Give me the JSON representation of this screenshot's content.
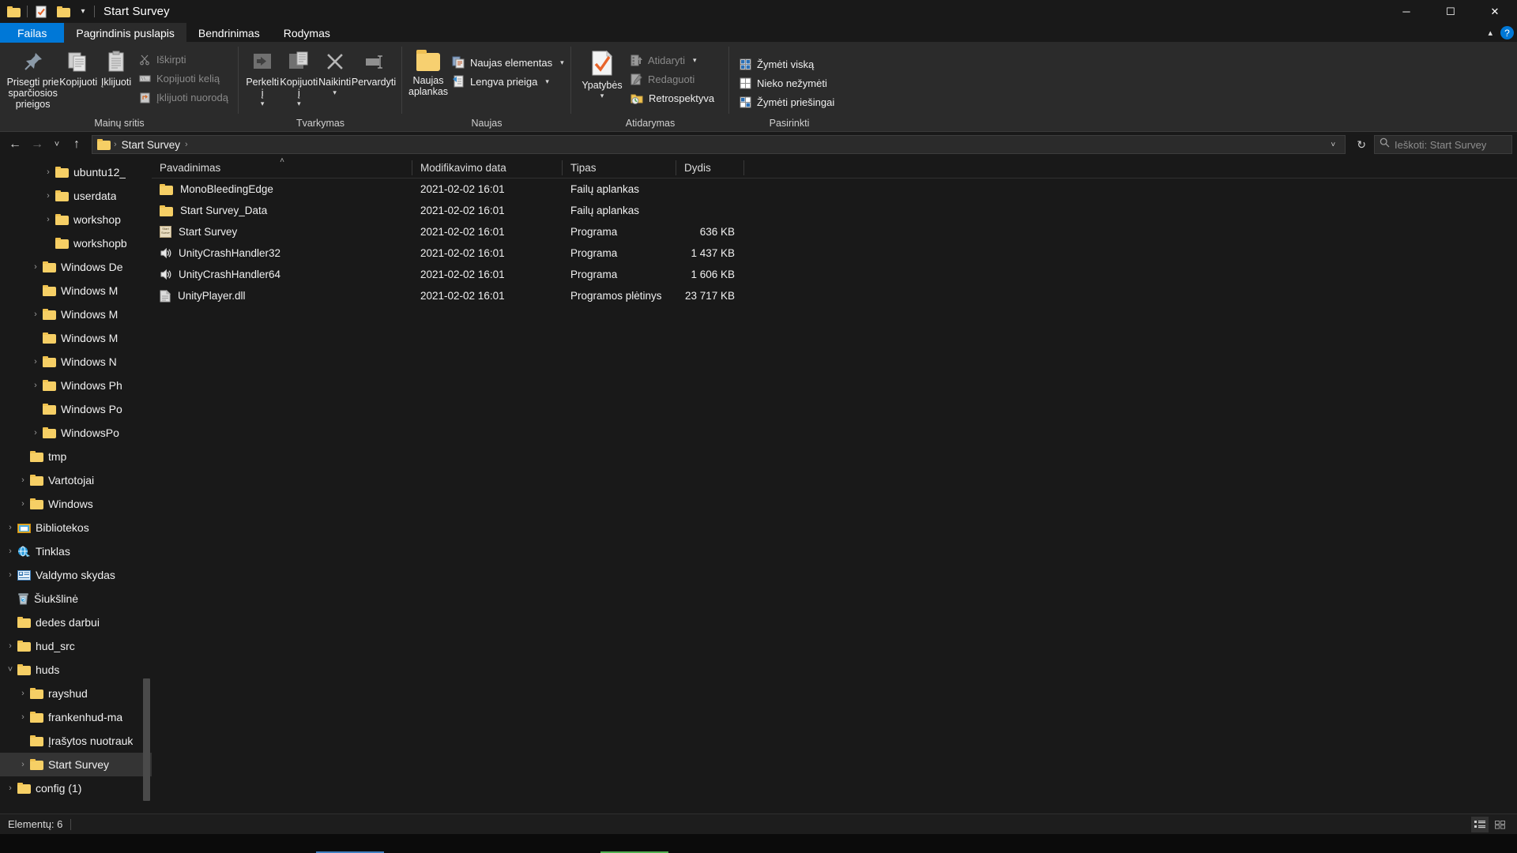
{
  "window": {
    "title": "Start Survey",
    "quick_access_icons": [
      "folder-icon",
      "properties-check-icon",
      "new-folder-icon"
    ],
    "customize_caret": "chevron-down-icon",
    "controls": {
      "minimize": "─",
      "maximize": "☐",
      "close": "✕"
    }
  },
  "tabs": [
    {
      "label": "Failas",
      "state": "file-menu"
    },
    {
      "label": "Pagrindinis puslapis",
      "state": "active"
    },
    {
      "label": "Bendrinimas",
      "state": "normal"
    },
    {
      "label": "Rodymas",
      "state": "normal"
    }
  ],
  "tabstrip_right": {
    "collapse": "chevron-up-icon",
    "help": "?"
  },
  "ribbon": {
    "groups": [
      {
        "title": "Mainų sritis",
        "big_buttons": [
          {
            "label": "Prisegti prie sparčiosios prieigos",
            "icon": "pin-icon"
          },
          {
            "label": "Kopijuoti",
            "icon": "copy-icon"
          },
          {
            "label": "Įklijuoti",
            "icon": "paste-icon"
          }
        ],
        "small_buttons": [
          {
            "label": "Iškirpti",
            "icon": "scissors-icon",
            "enabled": false
          },
          {
            "label": "Kopijuoti kelią",
            "icon": "copy-path-icon",
            "enabled": false
          },
          {
            "label": "Įklijuoti nuorodą",
            "icon": "paste-shortcut-icon",
            "enabled": false
          }
        ]
      },
      {
        "title": "Tvarkymas",
        "big_buttons": [
          {
            "label": "Perkelti į",
            "icon": "move-to-icon",
            "has_caret": true
          },
          {
            "label": "Kopijuoti į",
            "icon": "copy-to-icon",
            "has_caret": true
          },
          {
            "label": "Naikinti",
            "icon": "delete-x-icon",
            "has_caret": true
          },
          {
            "label": "Pervardyti",
            "icon": "rename-icon"
          }
        ]
      },
      {
        "title": "Naujas",
        "big_buttons": [
          {
            "label": "Naujas aplankas",
            "icon": "new-folder-icon"
          }
        ],
        "small_buttons": [
          {
            "label": "Naujas elementas",
            "icon": "new-item-icon",
            "has_caret": true
          },
          {
            "label": "Lengva prieiga",
            "icon": "easy-access-icon",
            "has_caret": true
          }
        ]
      },
      {
        "title": "Atidarymas",
        "big_buttons": [
          {
            "label": "Ypatybės",
            "icon": "properties-check-icon",
            "has_caret": true
          }
        ],
        "small_buttons": [
          {
            "label": "Atidaryti",
            "icon": "open-icon",
            "has_caret": true,
            "enabled": false
          },
          {
            "label": "Redaguoti",
            "icon": "edit-icon",
            "enabled": false
          },
          {
            "label": "Retrospektyva",
            "icon": "history-icon",
            "enabled": true
          }
        ]
      },
      {
        "title": "Pasirinkti",
        "small_buttons": [
          {
            "label": "Žymėti viską",
            "icon": "select-all-icon"
          },
          {
            "label": "Nieko nežymėti",
            "icon": "select-none-icon"
          },
          {
            "label": "Žymėti priešingai",
            "icon": "invert-selection-icon"
          }
        ]
      }
    ]
  },
  "addressbar": {
    "back": "←",
    "forward": "→",
    "recent": "˅",
    "up": "↑",
    "breadcrumb": [
      "Start Survey"
    ],
    "breadcrumb_leading_icon": "folder-icon",
    "dropdown_caret": "˅",
    "refresh": "↻",
    "search_placeholder": "Ieškoti: Start Survey",
    "search_value": "",
    "search_icon": "search-icon"
  },
  "navpane": {
    "items": [
      {
        "label": "ubuntu12_",
        "icon": "folder-icon",
        "twisty": "›",
        "indent": 3
      },
      {
        "label": "userdata",
        "icon": "folder-icon",
        "twisty": "›",
        "indent": 3
      },
      {
        "label": "workshop",
        "icon": "folder-icon",
        "twisty": "›",
        "indent": 3
      },
      {
        "label": "workshopb",
        "icon": "folder-icon",
        "twisty": "",
        "indent": 3
      },
      {
        "label": "Windows De",
        "icon": "folder-icon",
        "twisty": "›",
        "indent": 2
      },
      {
        "label": "Windows M",
        "icon": "folder-icon",
        "twisty": "",
        "indent": 2
      },
      {
        "label": "Windows M",
        "icon": "folder-icon",
        "twisty": "›",
        "indent": 2
      },
      {
        "label": "Windows M",
        "icon": "folder-icon",
        "twisty": "",
        "indent": 2
      },
      {
        "label": "Windows N",
        "icon": "folder-icon",
        "twisty": "›",
        "indent": 2
      },
      {
        "label": "Windows Ph",
        "icon": "folder-icon",
        "twisty": "›",
        "indent": 2
      },
      {
        "label": "Windows Po",
        "icon": "folder-icon",
        "twisty": "",
        "indent": 2
      },
      {
        "label": "WindowsPo",
        "icon": "folder-icon",
        "twisty": "›",
        "indent": 2
      },
      {
        "label": "tmp",
        "icon": "folder-icon",
        "twisty": "",
        "indent": 1
      },
      {
        "label": "Vartotojai",
        "icon": "folder-icon",
        "twisty": "›",
        "indent": 1
      },
      {
        "label": "Windows",
        "icon": "folder-icon",
        "twisty": "›",
        "indent": 1
      },
      {
        "label": "Bibliotekos",
        "icon": "libraries-icon",
        "twisty": "›",
        "indent": 0
      },
      {
        "label": "Tinklas",
        "icon": "network-icon",
        "twisty": "›",
        "indent": 0
      },
      {
        "label": "Valdymo skydas",
        "icon": "control-panel-icon",
        "twisty": "›",
        "indent": 0
      },
      {
        "label": "Šiukšlinė",
        "icon": "recycle-bin-icon",
        "twisty": "",
        "indent": 0
      },
      {
        "label": "dedes darbui",
        "icon": "folder-icon",
        "twisty": "",
        "indent": 0
      },
      {
        "label": "hud_src",
        "icon": "folder-icon",
        "twisty": "›",
        "indent": 0
      },
      {
        "label": "huds",
        "icon": "folder-icon",
        "twisty": "˅",
        "indent": 0
      },
      {
        "label": "rayshud",
        "icon": "folder-icon",
        "twisty": "›",
        "indent": 1
      },
      {
        "label": "frankenhud-ma",
        "icon": "folder-icon",
        "twisty": "›",
        "indent": 1
      },
      {
        "label": "Įrašytos nuotrauk",
        "icon": "folder-icon",
        "twisty": "",
        "indent": 1
      },
      {
        "label": "Start Survey",
        "icon": "folder-icon",
        "twisty": "›",
        "indent": 1,
        "selected": true
      },
      {
        "label": "config (1)",
        "icon": "folder-icon",
        "twisty": "›",
        "indent": 0
      }
    ]
  },
  "filelist": {
    "columns": [
      {
        "key": "name",
        "label": "Pavadinimas",
        "sorted": true,
        "sort_arrow": "˄"
      },
      {
        "key": "date",
        "label": "Modifikavimo data"
      },
      {
        "key": "type",
        "label": "Tipas"
      },
      {
        "key": "size",
        "label": "Dydis"
      }
    ],
    "rows": [
      {
        "name": "MonoBleedingEdge",
        "date": "2021-02-02 16:01",
        "type": "Failų aplankas",
        "size": "",
        "icon": "folder-icon"
      },
      {
        "name": "Start Survey_Data",
        "date": "2021-02-02 16:01",
        "type": "Failų aplankas",
        "size": "",
        "icon": "folder-icon"
      },
      {
        "name": "Start Survey",
        "date": "2021-02-02 16:01",
        "type": "Programa",
        "size": "636 KB",
        "icon": "unity-exe-icon"
      },
      {
        "name": "UnityCrashHandler32",
        "date": "2021-02-02 16:01",
        "type": "Programa",
        "size": "1 437 KB",
        "icon": "crash-handler-icon"
      },
      {
        "name": "UnityCrashHandler64",
        "date": "2021-02-02 16:01",
        "type": "Programa",
        "size": "1 606 KB",
        "icon": "crash-handler-icon"
      },
      {
        "name": "UnityPlayer.dll",
        "date": "2021-02-02 16:01",
        "type": "Programos plėtinys",
        "size": "23 717 KB",
        "icon": "dll-icon"
      }
    ]
  },
  "statusbar": {
    "count_text": "Elementų: 6",
    "views": [
      {
        "name": "details-view",
        "active": true
      },
      {
        "name": "large-icons-view",
        "active": false
      }
    ]
  },
  "colors": {
    "accent": "#0078d7",
    "window_bg": "#191919",
    "ribbon_bg": "#2b2b2b",
    "folder_yellow": "#f6cf65",
    "selection": "#343434"
  }
}
